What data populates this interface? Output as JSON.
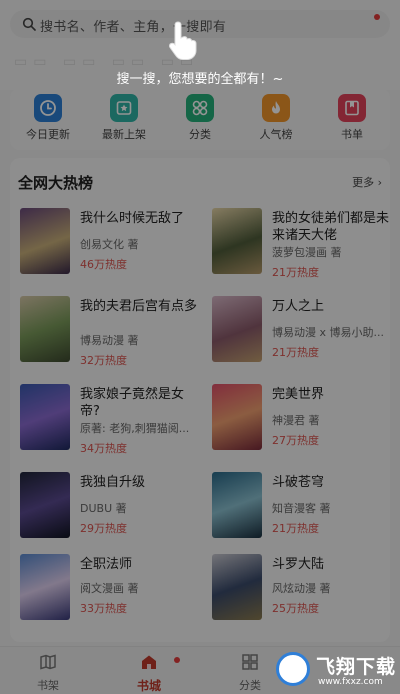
{
  "search": {
    "placeholder": "搜书名、作者、主角，一搜即有",
    "hint": "搜一搜，您想要的全都有！~"
  },
  "quick_nav": [
    {
      "label": "今日更新",
      "icon": "clock-icon",
      "color": "#2b7fd4"
    },
    {
      "label": "最新上架",
      "icon": "star-icon",
      "color": "#2fb3a6"
    },
    {
      "label": "分类",
      "icon": "grid-icon",
      "color": "#25b07a"
    },
    {
      "label": "人气榜",
      "icon": "flame-icon",
      "color": "#f0952a"
    },
    {
      "label": "书单",
      "icon": "book-icon",
      "color": "#e2435a"
    }
  ],
  "hot_list": {
    "title": "全网大热榜",
    "more": "更多",
    "books": [
      {
        "title": "我什么时候无敌了",
        "author": "创易文化 著",
        "heat": "46万热度"
      },
      {
        "title": "我的女徒弟们都是未来诸天大佬",
        "author": "菠萝包漫画 著",
        "heat": "21万热度"
      },
      {
        "title": "我的夫君后宫有点多",
        "author": "博易动漫 著",
        "heat": "32万热度"
      },
      {
        "title": "万人之上",
        "author": "博易动漫 x 博易小助...",
        "heat": "21万热度"
      },
      {
        "title": "我家娘子竟然是女帝?",
        "author": "原著: 老狗,刺猬猫阅...",
        "heat": "34万热度"
      },
      {
        "title": "完美世界",
        "author": "神漫君 著",
        "heat": "27万热度"
      },
      {
        "title": "我独自升级",
        "author": "DUBU 著",
        "heat": "29万热度"
      },
      {
        "title": "斗破苍穹",
        "author": "知音漫客 著",
        "heat": "21万热度"
      },
      {
        "title": "全职法师",
        "author": "阅文漫画 著",
        "heat": "33万热度"
      },
      {
        "title": "斗罗大陆",
        "author": "风炫动漫 著",
        "heat": "25万热度"
      }
    ]
  },
  "bottom_nav": [
    {
      "label": "书架",
      "icon": "bookshelf-icon"
    },
    {
      "label": "书城",
      "icon": "store-icon",
      "active": true
    },
    {
      "label": "分类",
      "icon": "category-icon"
    }
  ],
  "watermark": {
    "logo_text": "飞翔下载",
    "url": "www.fxxz.com"
  },
  "colors": {
    "accent": "#c0392b",
    "heat": "#d9534f",
    "badge": "#e23b3b"
  }
}
